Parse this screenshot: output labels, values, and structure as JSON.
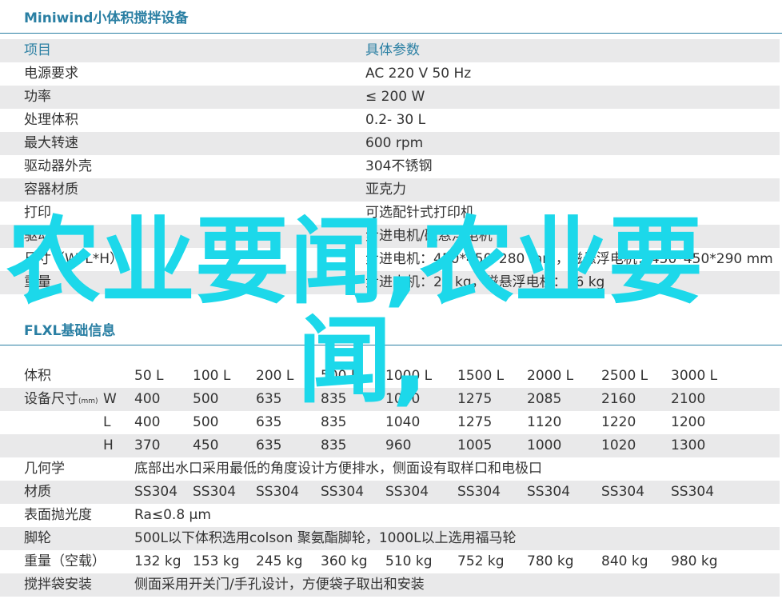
{
  "spec": {
    "title": "Miniwind小体积搅拌设备",
    "header": {
      "item": "项目",
      "value": "具体参数"
    },
    "rows": [
      {
        "label": "电源要求",
        "value": "AC 220  V 50 Hz"
      },
      {
        "label": "功率",
        "value": "≤ 200 W"
      },
      {
        "label": "处理体积",
        "value": "0.2- 30 L"
      },
      {
        "label": "最大转速",
        "value": "600  rpm"
      },
      {
        "label": "驱动器外壳",
        "value": "304不锈钢"
      },
      {
        "label": "容器材质",
        "value": "亚克力"
      },
      {
        "label": "打印",
        "value": "可选配针式打印机"
      },
      {
        "label": "驱动",
        "value": "步进电机/磁悬浮电机"
      },
      {
        "label": "尺寸（W*L*H）",
        "value": "步进电机：450*450*280 mm，磁悬浮电机：450*450*290 mm"
      },
      {
        "label": "重量",
        "value": "步进电机：20 kg，磁悬浮电机：16 kg"
      }
    ]
  },
  "flxl": {
    "title": "FLXL基础信息",
    "volume": {
      "label": "体积",
      "values": [
        "50 L",
        "100 L",
        "200 L",
        "500 L",
        "1000 L",
        "1500 L",
        "2000 L",
        "2500 L",
        "3000 L"
      ]
    },
    "size": {
      "label": "设备尺寸",
      "unit": "(mm)",
      "rows": [
        {
          "axis": "W",
          "values": [
            "400",
            "500",
            "635",
            "835",
            "1040",
            "1275",
            "2085",
            "2160",
            "2100"
          ]
        },
        {
          "axis": "L",
          "values": [
            "400",
            "500",
            "635",
            "835",
            "1040",
            "1275",
            "1120",
            "1220",
            "1200"
          ]
        },
        {
          "axis": "H",
          "values": [
            "370",
            "450",
            "635",
            "835",
            "960",
            "1005",
            "1000",
            "1020",
            "1300"
          ]
        }
      ]
    },
    "geometry": {
      "label": "几何学",
      "value": "底部出水口采用最低的角度设计方便排水，侧面设有取样口和电极口"
    },
    "material": {
      "label": "材质",
      "values": [
        "SS304",
        "SS304",
        "SS304",
        "SS304",
        "SS304",
        "SS304",
        "SS304",
        "SS304",
        "SS304"
      ]
    },
    "polish": {
      "label": "表面抛光度",
      "value": "Ra≤0.8 μm"
    },
    "casters": {
      "label": "脚轮",
      "value": "500L以下体积选用colson 聚氨酯脚轮，1000L以上选用福马轮"
    },
    "weight": {
      "label": "重量（空载）",
      "values": [
        "132 kg",
        "153 kg",
        "245 kg",
        "360 kg",
        "510 kg",
        "752 kg",
        "780 kg",
        "840 kg",
        "980 kg"
      ]
    },
    "bag": {
      "label": "搅拌袋安装",
      "value": "侧面采用开关门/手孔设计，方便袋子取出和安装"
    }
  },
  "watermark": {
    "line1": "农业要闻,农业要",
    "line2": "闻,"
  }
}
